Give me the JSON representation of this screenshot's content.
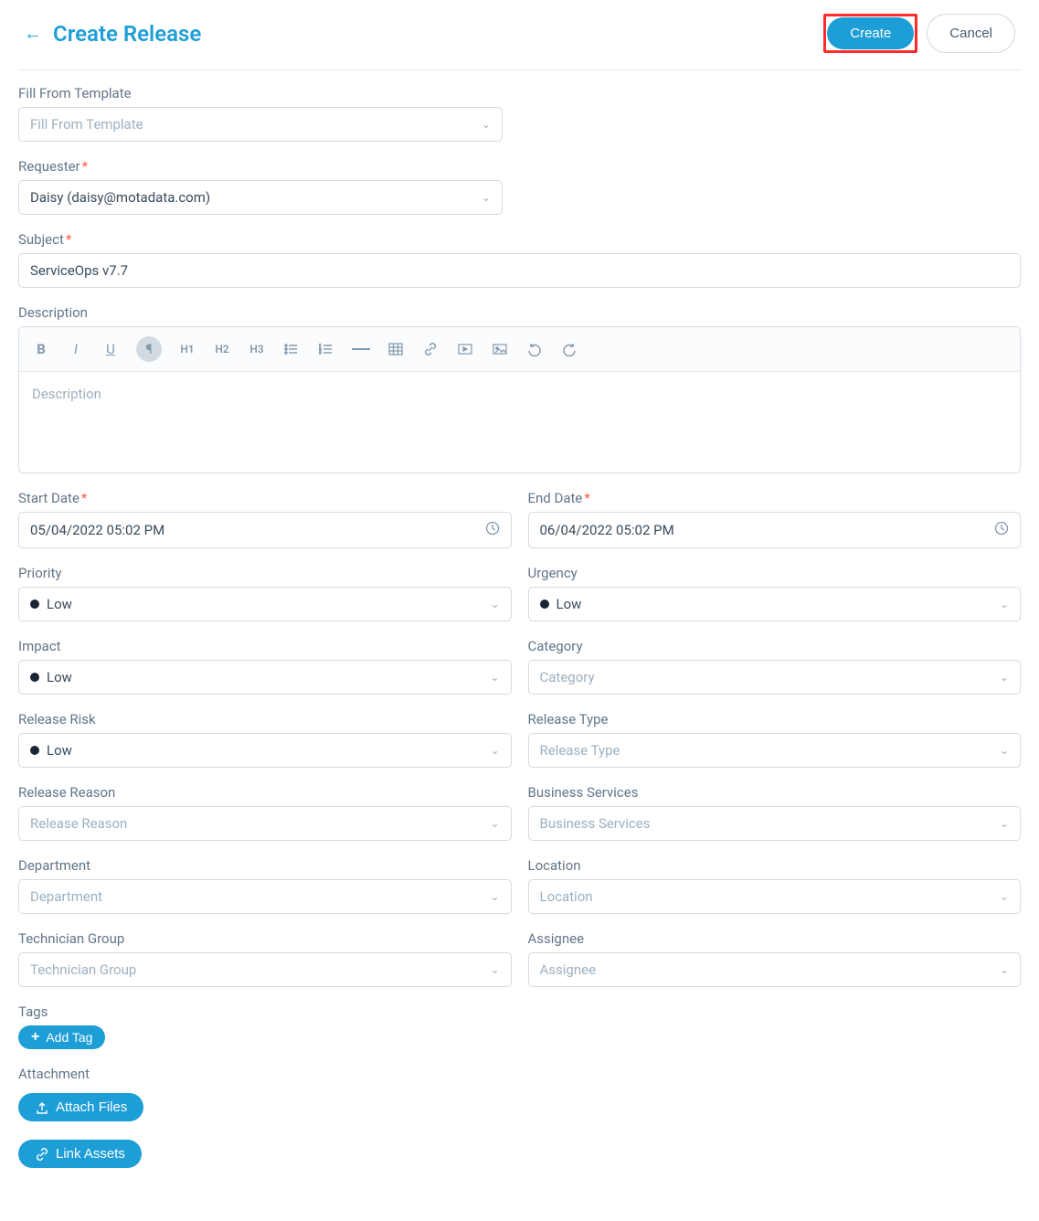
{
  "header": {
    "title": "Create Release",
    "create_label": "Create",
    "cancel_label": "Cancel"
  },
  "fields": {
    "fill_template": {
      "label": "Fill From Template",
      "placeholder": "Fill From Template"
    },
    "requester": {
      "label": "Requester",
      "value": "Daisy (daisy@motadata.com)"
    },
    "subject": {
      "label": "Subject",
      "value": "ServiceOps v7.7"
    },
    "description": {
      "label": "Description",
      "placeholder": "Description"
    },
    "start_date": {
      "label": "Start Date",
      "value": "05/04/2022 05:02 PM"
    },
    "end_date": {
      "label": "End Date",
      "value": "06/04/2022 05:02 PM"
    },
    "priority": {
      "label": "Priority",
      "value": "Low"
    },
    "urgency": {
      "label": "Urgency",
      "value": "Low"
    },
    "impact": {
      "label": "Impact",
      "value": "Low"
    },
    "category": {
      "label": "Category",
      "placeholder": "Category"
    },
    "release_risk": {
      "label": "Release Risk",
      "value": "Low"
    },
    "release_type": {
      "label": "Release Type",
      "placeholder": "Release Type"
    },
    "release_reason": {
      "label": "Release Reason",
      "placeholder": "Release Reason"
    },
    "business_services": {
      "label": "Business Services",
      "placeholder": "Business Services"
    },
    "department": {
      "label": "Department",
      "placeholder": "Department"
    },
    "location": {
      "label": "Location",
      "placeholder": "Location"
    },
    "technician_group": {
      "label": "Technician Group",
      "placeholder": "Technician Group"
    },
    "assignee": {
      "label": "Assignee",
      "placeholder": "Assignee"
    },
    "tags": {
      "label": "Tags",
      "add_label": "Add Tag"
    },
    "attachment": {
      "label": "Attachment",
      "attach_label": "Attach Files",
      "link_assets_label": "Link Assets"
    }
  },
  "rte": {
    "h1": "H1",
    "h2": "H2",
    "h3": "H3"
  }
}
